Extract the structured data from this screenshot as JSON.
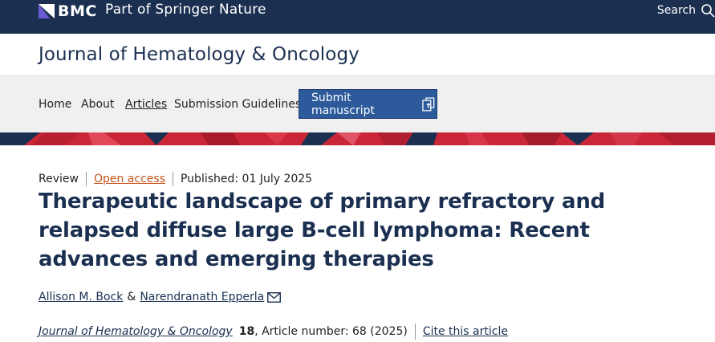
{
  "topbar": {
    "brand": "BMC",
    "tagline": "Part of Springer Nature",
    "search_label": "Search"
  },
  "journal": {
    "title": "Journal of Hematology & Oncology"
  },
  "nav": {
    "items": [
      {
        "label": "Home"
      },
      {
        "label": "About"
      },
      {
        "label": "Articles"
      },
      {
        "label": "Submission Guidelines"
      }
    ],
    "submit_label": "Submit manuscript"
  },
  "article": {
    "type": "Review",
    "access": "Open access",
    "published": "Published: 01 July 2025",
    "title": "Therapeutic landscape of primary refractory and relapsed diffuse large B-cell lymphoma: Recent advances and emerging therapies",
    "authors": [
      {
        "name": "Allison M. Bock"
      },
      {
        "name": "Narendranath Epperla"
      }
    ],
    "author_separator": "&",
    "citation": {
      "journal": "Journal of Hematology & Oncology",
      "volume": "18",
      "article_number": ", Article number: 68 (2025)",
      "cite_label": "Cite this article"
    }
  },
  "colors": {
    "navy": "#1b3051",
    "button": "#2c5a9a",
    "accent_red": "#c92637",
    "open_access": "#c9541c"
  }
}
